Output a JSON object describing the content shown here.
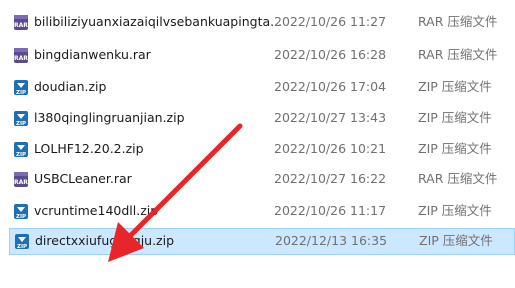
{
  "files": [
    {
      "name": "bilibiliziyuanxiazaiqilvsebankuapingta...",
      "date": "2022/10/26 11:27",
      "type": "RAR 压缩文件",
      "icon": "rar-archive-icon"
    },
    {
      "name": "bingdianwenku.rar",
      "date": "2022/10/26 16:28",
      "type": "RAR 压缩文件",
      "icon": "rar-archive-icon"
    },
    {
      "name": "doudian.zip",
      "date": "2022/10/26 17:04",
      "type": "ZIP 压缩文件",
      "icon": "zip-archive-icon"
    },
    {
      "name": "l380qinglingruanjian.zip",
      "date": "2022/10/27 13:43",
      "type": "ZIP 压缩文件",
      "icon": "zip-archive-icon"
    },
    {
      "name": "LOLHF12.20.2.zip",
      "date": "2022/10/26 10:21",
      "type": "ZIP 压缩文件",
      "icon": "zip-archive-icon"
    },
    {
      "name": "USBCLeaner.rar",
      "date": "2022/10/27 16:22",
      "type": "RAR 压缩文件",
      "icon": "rar-archive-icon"
    },
    {
      "name": "vcruntime140dll.zip",
      "date": "2022/10/26 11:17",
      "type": "ZIP 压缩文件",
      "icon": "zip-archive-icon"
    },
    {
      "name": "directxxiufugongju.zip",
      "date": "2022/12/13 16:35",
      "type": "ZIP 压缩文件",
      "icon": "zip-archive-icon",
      "selected": true
    }
  ],
  "colors": {
    "selection_fill": "#cce8ff",
    "selection_border": "#99d1ff",
    "arrow": "#e8262a"
  }
}
